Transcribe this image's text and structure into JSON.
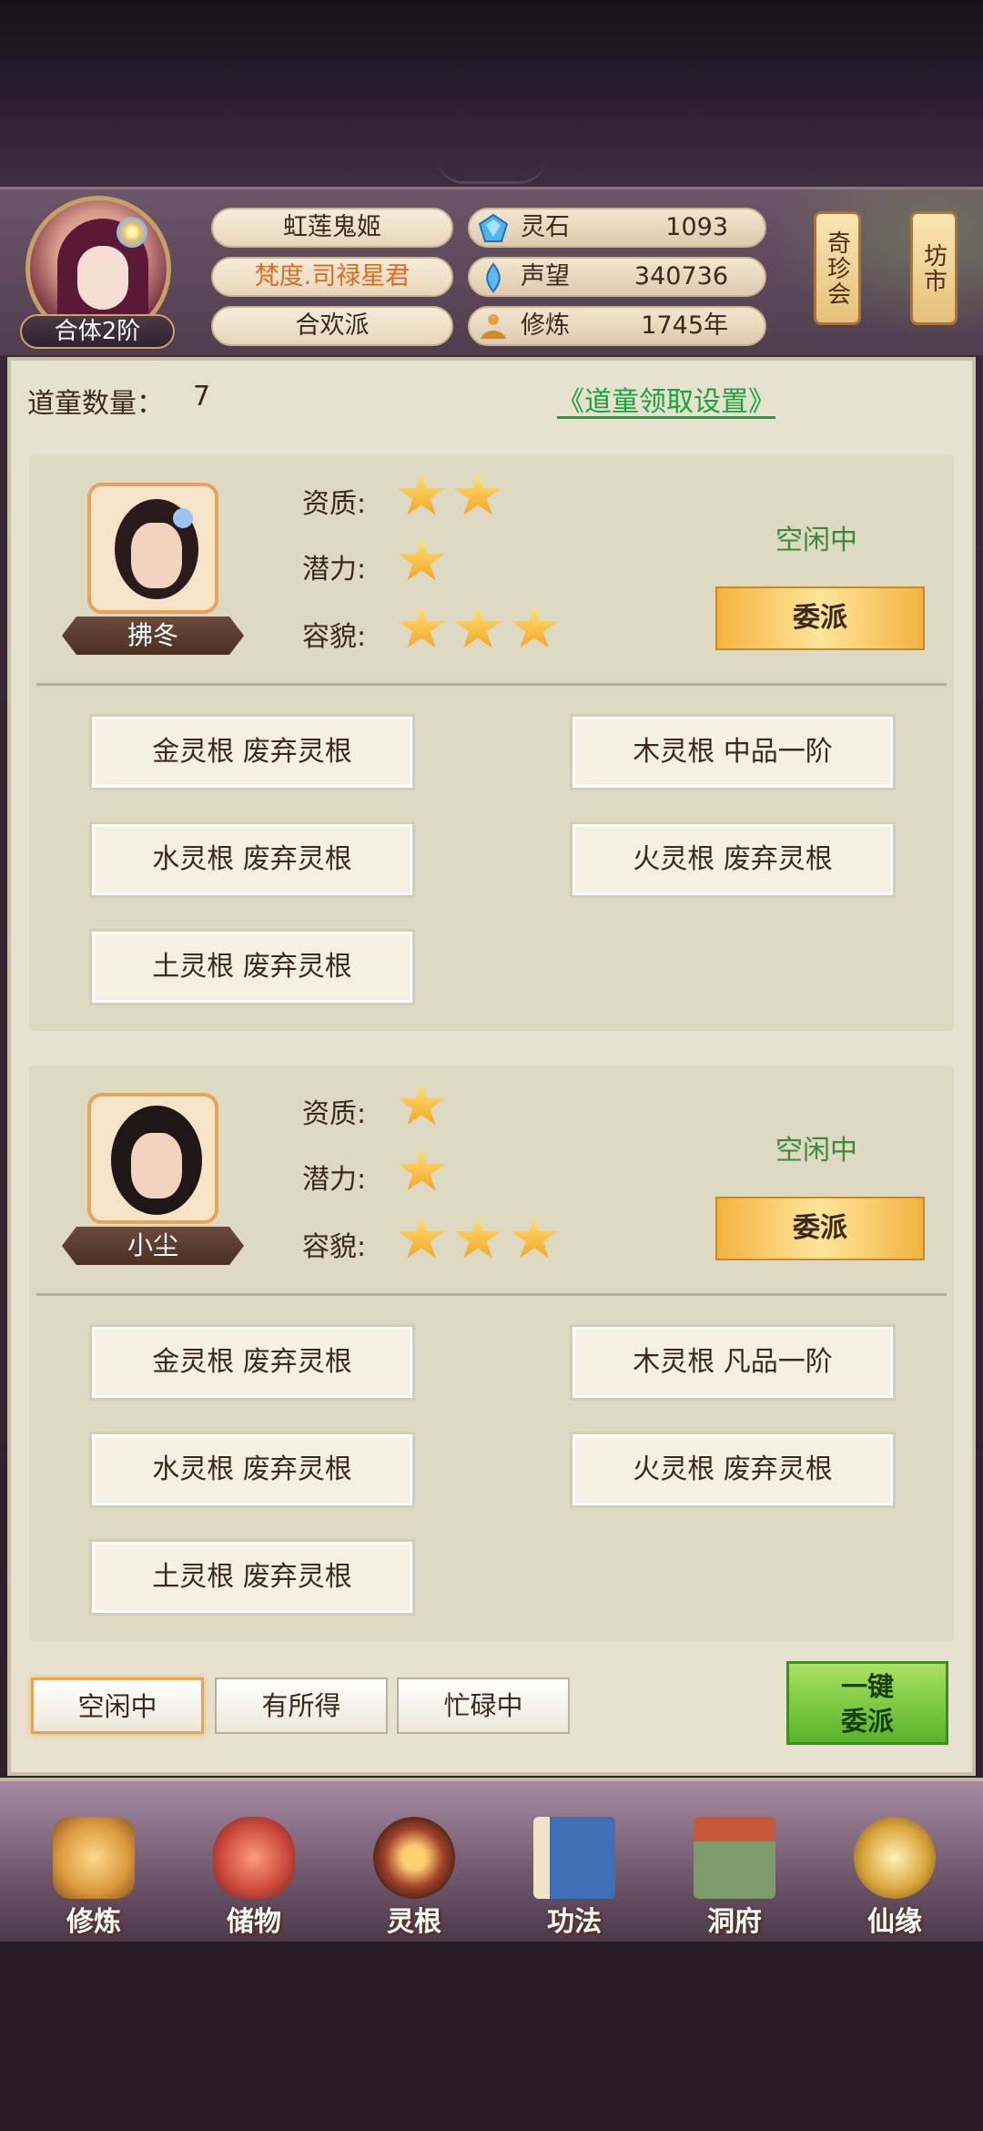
{
  "player": {
    "name": "虹莲鬼姬",
    "title": "梵度.司禄星君",
    "sect": "合欢派",
    "rank": "合体2阶"
  },
  "resources": [
    {
      "icon": "spirit-stone-icon",
      "label": "灵石",
      "value": "1093"
    },
    {
      "icon": "reputation-icon",
      "label": "声望",
      "value": "340736"
    },
    {
      "icon": "cultivation-icon",
      "label": "修炼",
      "value": "1745年"
    }
  ],
  "side_buttons": {
    "treasure_hall": "奇珍会",
    "market": "坊市"
  },
  "page": {
    "count_label": "道童数量：",
    "count_value": "7",
    "settings_link": "《道童领取设置》"
  },
  "attr_labels": {
    "aptitude": "资质:",
    "potential": "潜力:",
    "appearance": "容貌:"
  },
  "apprentices": [
    {
      "name": "拂冬",
      "aptitude_stars": 2,
      "potential_stars": 1,
      "appearance_stars": 3,
      "status": "空闲中",
      "dispatch_label": "委派",
      "roots": [
        "金灵根 废弃灵根",
        "木灵根 中品一阶",
        "水灵根 废弃灵根",
        "火灵根 废弃灵根",
        "土灵根 废弃灵根"
      ]
    },
    {
      "name": "小尘",
      "aptitude_stars": 1,
      "potential_stars": 1,
      "appearance_stars": 3,
      "status": "空闲中",
      "dispatch_label": "委派",
      "roots": [
        "金灵根 废弃灵根",
        "木灵根 凡品一阶",
        "水灵根 废弃灵根",
        "火灵根 废弃灵根",
        "土灵根 废弃灵根"
      ]
    }
  ],
  "filters": [
    "空闲中",
    "有所得",
    "忙碌中"
  ],
  "active_filter": "空闲中",
  "one_click": {
    "line1": "一键",
    "line2": "委派"
  },
  "nav": [
    {
      "label": "修炼",
      "icon": "cultivate-icon",
      "color": "#d99a3c"
    },
    {
      "label": "储物",
      "icon": "storage-bag-icon",
      "color": "#c8463a"
    },
    {
      "label": "灵根",
      "icon": "spirit-root-icon",
      "color": "#a3422a"
    },
    {
      "label": "功法",
      "icon": "technique-book-icon",
      "color": "#3f6fb5"
    },
    {
      "label": "洞府",
      "icon": "cave-dwelling-icon",
      "color": "#7d9a6b"
    },
    {
      "label": "仙缘",
      "icon": "immortal-fate-icon",
      "color": "#d9a63c"
    }
  ]
}
